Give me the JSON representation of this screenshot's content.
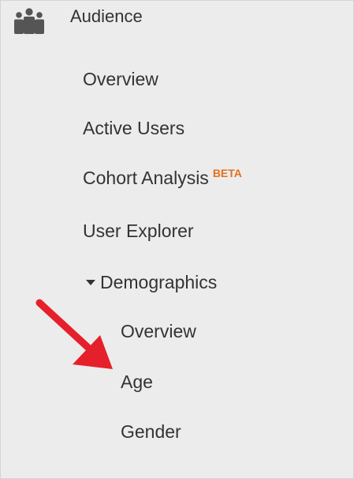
{
  "section": {
    "title": "Audience",
    "icon": "audience-people-icon"
  },
  "nav": {
    "items": [
      {
        "label": "Overview"
      },
      {
        "label": "Active Users"
      },
      {
        "label": "Cohort Analysis",
        "badge": "BETA"
      },
      {
        "label": "User Explorer"
      },
      {
        "label": "Demographics",
        "expanded": true
      }
    ],
    "demographics_children": [
      {
        "label": "Overview"
      },
      {
        "label": "Age",
        "highlighted": true
      },
      {
        "label": "Gender"
      }
    ]
  },
  "annotation": {
    "type": "red-arrow",
    "color": "#e5202a",
    "points_to": "Age"
  },
  "colors": {
    "background": "#ececec",
    "text": "#333333",
    "beta": "#e3701f",
    "icon": "#555555"
  }
}
